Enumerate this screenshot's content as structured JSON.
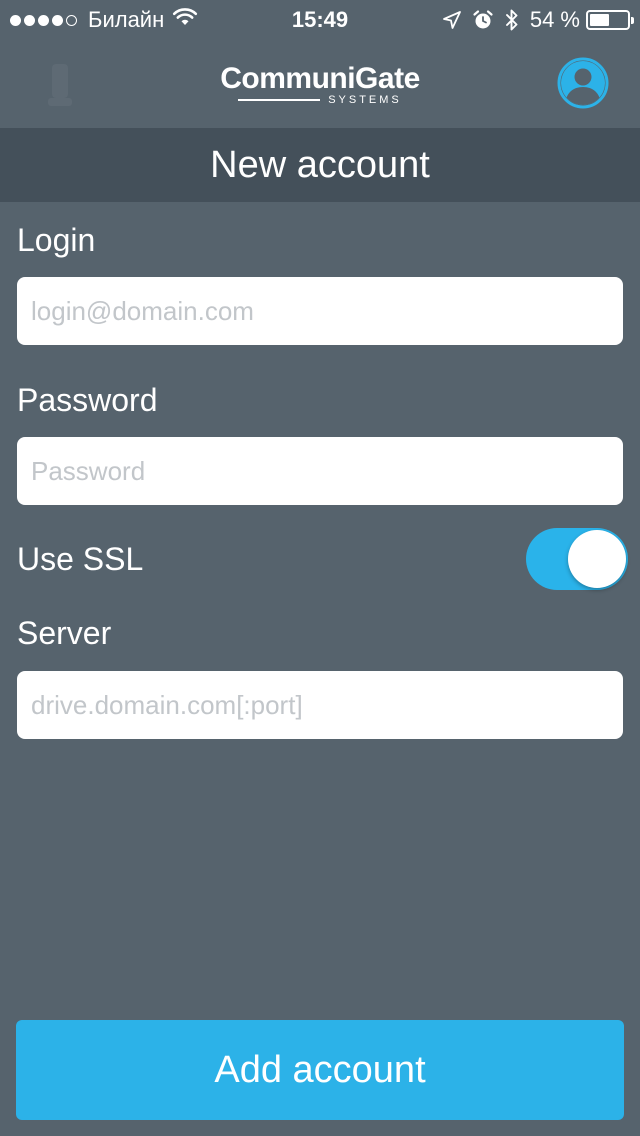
{
  "status_bar": {
    "carrier": "Билайн",
    "time": "15:49",
    "battery": "54 %",
    "battery_level": 0.54
  },
  "nav": {
    "logo_main": "CommuniGate",
    "logo_sub": "SYSTEMS",
    "profile_icon": "user-avatar-icon"
  },
  "header": {
    "title": "New account"
  },
  "form": {
    "login": {
      "label": "Login",
      "placeholder": "login@domain.com",
      "value": ""
    },
    "password": {
      "label": "Password",
      "placeholder": "Password",
      "value": ""
    },
    "ssl": {
      "label": "Use SSL",
      "enabled": true
    },
    "server": {
      "label": "Server",
      "placeholder": "drive.domain.com[:port]",
      "value": ""
    }
  },
  "actions": {
    "add_label": "Add account"
  },
  "colors": {
    "background": "#56636d",
    "title_bar": "#44505a",
    "accent": "#2cb2e8"
  }
}
